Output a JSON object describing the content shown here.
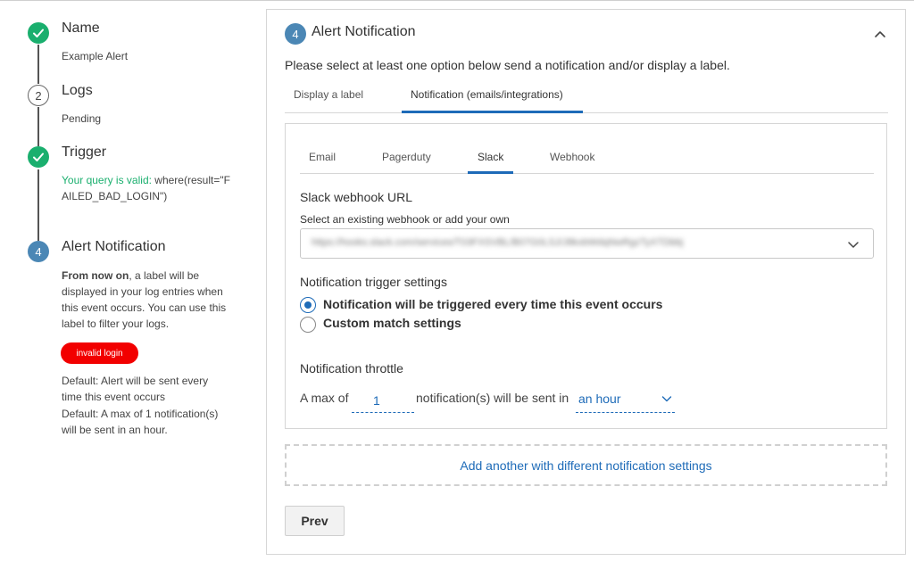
{
  "stepper": {
    "steps": [
      {
        "title": "Name",
        "sub": "Example Alert",
        "state": "done"
      },
      {
        "number": "2",
        "title": "Logs",
        "sub": "Pending",
        "state": "pending"
      },
      {
        "title": "Trigger",
        "valid_prefix": "Your query is valid:",
        "query": "where(result=\"FAILED_BAD_LOGIN\")",
        "state": "done"
      },
      {
        "number": "4",
        "title": "Alert Notification",
        "state": "active"
      }
    ],
    "description_bold": "From now on",
    "description_rest": ", a label will be displayed in your log entries when this event occurs. You can use this label to filter your logs.",
    "label_pill": "invalid login",
    "default_1": "Default: Alert will be sent every time this event occurs",
    "default_2": "Default: A max of 1 notification(s) will be sent in an hour."
  },
  "panel": {
    "step_number": "4",
    "title": "Alert Notification",
    "instruction": "Please select at least one option below send a notification and/or display a label.",
    "tabs": [
      "Display a label",
      "Notification (emails/integrations)"
    ],
    "active_tab": 1,
    "channel_tabs": [
      "Email",
      "Pagerduty",
      "Slack",
      "Webhook"
    ],
    "active_channel": 2,
    "slack": {
      "webhook_heading": "Slack webhook URL",
      "webhook_hint": "Select an existing webhook or add your own",
      "webhook_value": "https://hooks.slack.com/services/T03FXSVBL/B07G0LSJ/J8kxbWdqNwRgzTyXTDbbj"
    },
    "trigger": {
      "heading": "Notification trigger settings",
      "options": [
        "Notification will be triggered every time this event occurs",
        "Custom match settings"
      ],
      "selected": 0
    },
    "throttle": {
      "heading": "Notification throttle",
      "prefix": "A max of",
      "quantity": "1",
      "middle": "notification(s) will be sent in",
      "period": "an hour"
    },
    "add_another": "Add another with different notification settings",
    "prev_button": "Prev"
  },
  "colors": {
    "accent": "#1e6bb8",
    "success": "#1aaf6e",
    "step_active": "#4b87b5",
    "danger": "#f20000"
  }
}
